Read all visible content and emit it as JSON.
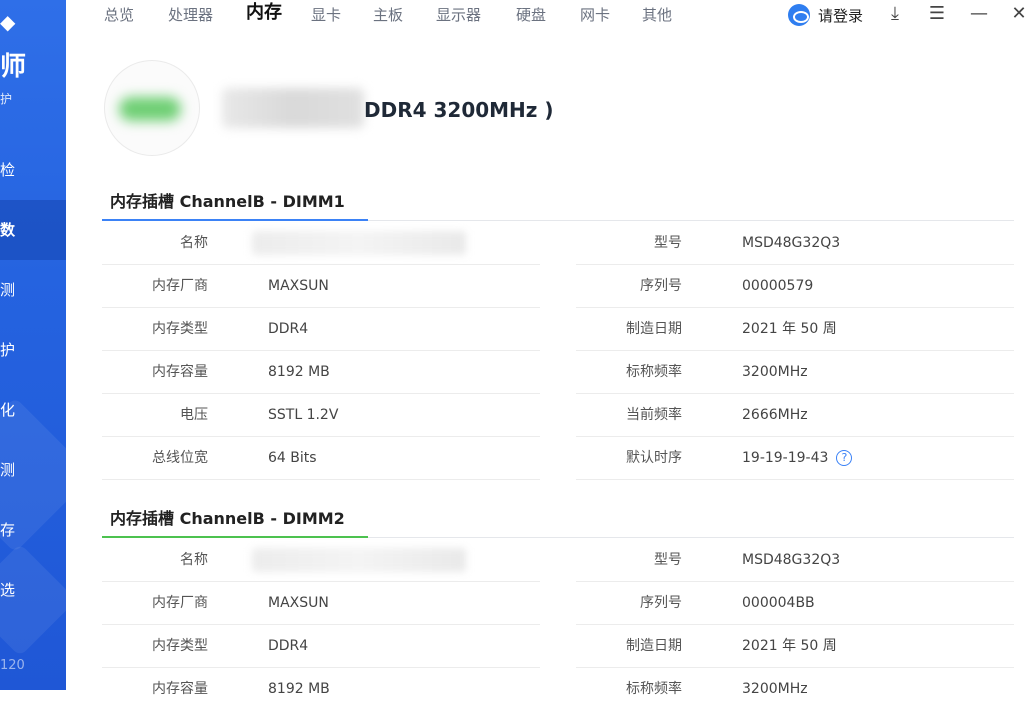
{
  "sidebar": {
    "title": "师",
    "subtitle": "护",
    "items": [
      {
        "label": "检"
      },
      {
        "label": "数"
      },
      {
        "label": "测"
      },
      {
        "label": "护"
      },
      {
        "label": "化"
      },
      {
        "label": "测"
      },
      {
        "label": "存"
      },
      {
        "label": "选"
      }
    ],
    "version": "120"
  },
  "tabs": [
    {
      "label": "总览"
    },
    {
      "label": "处理器"
    },
    {
      "label": "内存"
    },
    {
      "label": "显卡"
    },
    {
      "label": "主板"
    },
    {
      "label": "显示器"
    },
    {
      "label": "硬盘"
    },
    {
      "label": "网卡"
    },
    {
      "label": "其他"
    }
  ],
  "header": {
    "login_label": "请登录",
    "download_glyph": "⤓",
    "menu_glyph": "☰",
    "minimize_glyph": "—",
    "close_glyph": "✕"
  },
  "summary": {
    "title": "DDR4 3200MHz )"
  },
  "slots": [
    {
      "title": "内存插槽 ChannelB - DIMM1",
      "accent": "#3b82f6",
      "left": [
        {
          "k": "名称",
          "v": ""
        },
        {
          "k": "内存厂商",
          "v": "MAXSUN"
        },
        {
          "k": "内存类型",
          "v": "DDR4"
        },
        {
          "k": "内存容量",
          "v": "8192 MB"
        },
        {
          "k": "电压",
          "v": "SSTL 1.2V"
        },
        {
          "k": "总线位宽",
          "v": "64 Bits"
        }
      ],
      "right": [
        {
          "k": "型号",
          "v": "MSD48G32Q3"
        },
        {
          "k": "序列号",
          "v": "00000579"
        },
        {
          "k": "制造日期",
          "v": "2021 年 50 周"
        },
        {
          "k": "标称频率",
          "v": "3200MHz"
        },
        {
          "k": "当前频率",
          "v": "2666MHz"
        },
        {
          "k": "默认时序",
          "v": "19-19-19-43"
        }
      ]
    },
    {
      "title": "内存插槽 ChannelB - DIMM2",
      "accent": "#4cc24f",
      "left": [
        {
          "k": "名称",
          "v": ""
        },
        {
          "k": "内存厂商",
          "v": "MAXSUN"
        },
        {
          "k": "内存类型",
          "v": "DDR4"
        },
        {
          "k": "内存容量",
          "v": "8192 MB"
        }
      ],
      "right": [
        {
          "k": "型号",
          "v": "MSD48G32Q3"
        },
        {
          "k": "序列号",
          "v": "000004BB"
        },
        {
          "k": "制造日期",
          "v": "2021 年 50 周"
        },
        {
          "k": "标称频率",
          "v": "3200MHz"
        }
      ]
    }
  ],
  "help_glyph": "?"
}
